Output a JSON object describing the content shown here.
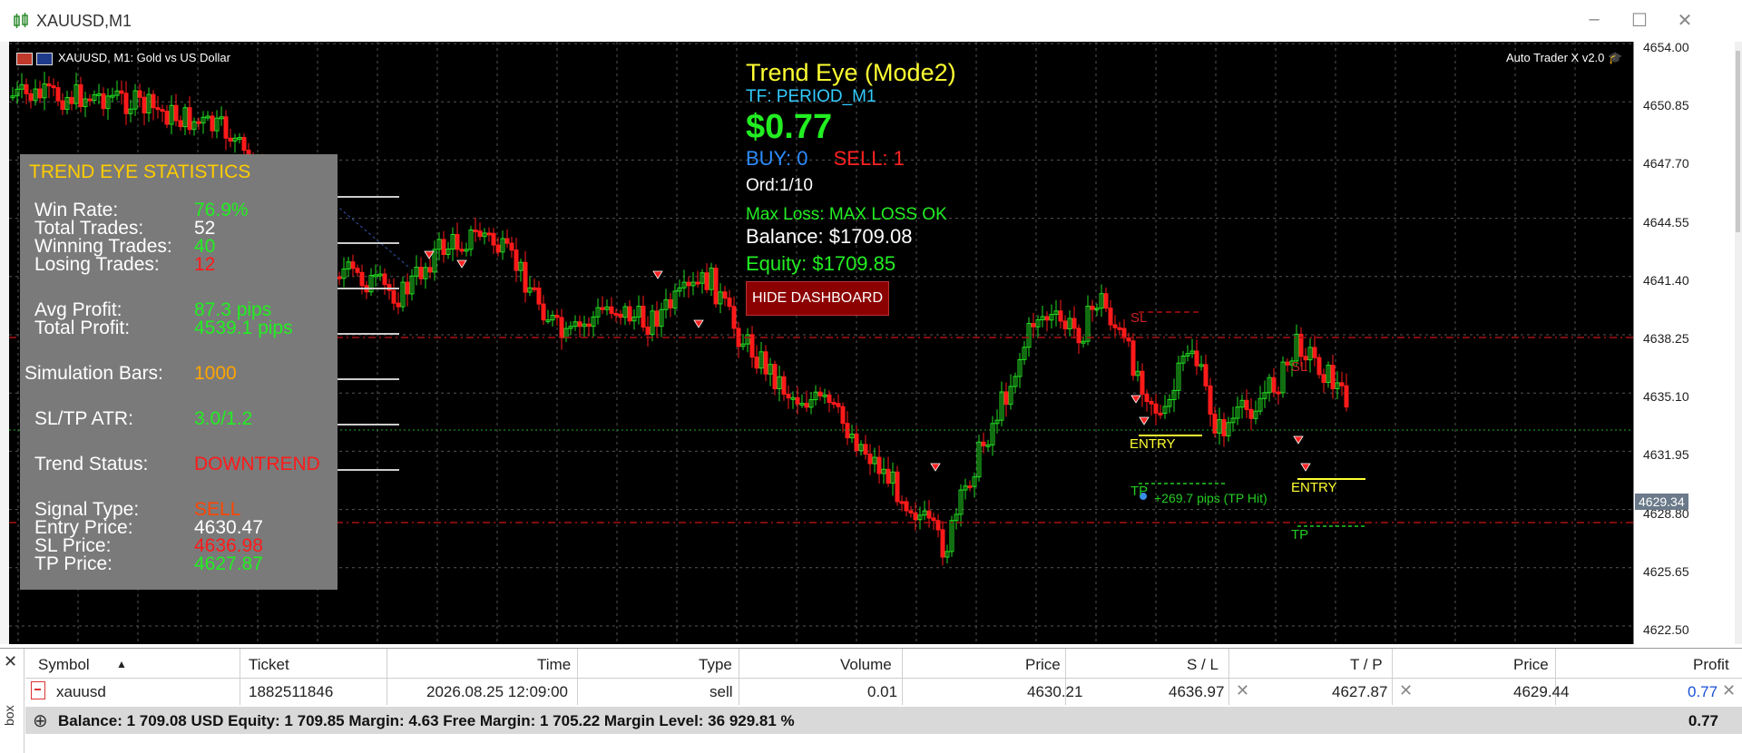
{
  "window": {
    "title": "XAUUSD,M1"
  },
  "chart": {
    "info": "XAUUSD, M1:  Gold vs US Dollar",
    "brand": "Auto Trader X v2.0",
    "price_levels": [
      "4654.00",
      "4650.85",
      "4647.70",
      "4644.55",
      "4641.40",
      "4638.25",
      "4635.10",
      "4631.95",
      "4628.80",
      "4625.65",
      "4622.50"
    ],
    "current_price": "4629.34",
    "labels": {
      "sl1": "SL",
      "sl2": "SL",
      "entry1": "ENTRY",
      "entry2": "ENTRY",
      "tp1": "TP",
      "tp2": "TP",
      "tp_hit": "+269.7 pips (TP Hit)"
    }
  },
  "dashboard": {
    "title": "Trend Eye (Mode2)",
    "tf": "TF: PERIOD_M1",
    "profit": "$0.77",
    "buy": "BUY: 0",
    "sell": "SELL: 1",
    "orders": "Ord:1/10",
    "max_loss": "Max Loss: MAX LOSS OK",
    "balance": "Balance: $1709.08",
    "equity": "Equity: $1709.85",
    "hide_button": "HIDE DASHBOARD"
  },
  "stats": {
    "title": "TREND EYE STATISTICS",
    "win_rate_label": "Win Rate:",
    "win_rate": "76.9%",
    "total_trades_label": "Total Trades:",
    "total_trades": "52",
    "winning_trades_label": "Winning Trades:",
    "winning_trades": "40",
    "losing_trades_label": "Losing Trades:",
    "losing_trades": "12",
    "avg_profit_label": "Avg Profit:",
    "avg_profit": "87.3 pips",
    "total_profit_label": "Total Profit:",
    "total_profit": "4539.1 pips",
    "sim_bars_label": "Simulation Bars:",
    "sim_bars": "1000",
    "sltp_label": "SL/TP ATR:",
    "sltp": "3.0/1.2",
    "trend_label": "Trend Status:",
    "trend": "DOWNTREND",
    "signal_label": "Signal Type:",
    "signal": "SELL",
    "entry_label": "Entry Price:",
    "entry": "4630.47",
    "sl_label": "SL Price:",
    "sl": "4636.98",
    "tp_label": "TP Price:",
    "tp": "4627.87"
  },
  "toolbox": {
    "side_label": "box",
    "headers": [
      "Symbol",
      "Ticket",
      "Time",
      "Type",
      "Volume",
      "Price",
      "S / L",
      "T / P",
      "Price",
      "Profit"
    ],
    "row": {
      "symbol": "xauusd",
      "ticket": "1882511846",
      "time": "2026.08.25 12:09:00",
      "type": "sell",
      "volume": "0.01",
      "price": "4630.21",
      "sl": "4636.97",
      "tp": "4627.87",
      "cur_price": "4629.44",
      "profit": "0.77"
    },
    "summary": "Balance: 1 709.08 USD  Equity: 1 709.85  Margin: 4.63  Free Margin: 1 705.22  Margin Level: 36 929.81 %",
    "summary_profit": "0.77"
  },
  "colors": {
    "bull": "#22dd22",
    "bear": "#ff1a1a",
    "profit_blue": "#1a4fd6"
  }
}
